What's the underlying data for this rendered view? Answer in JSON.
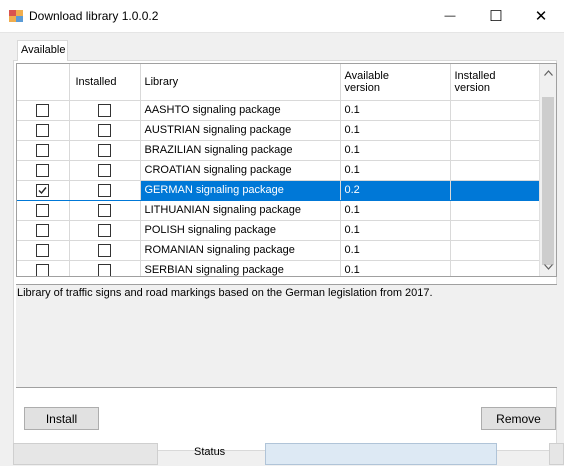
{
  "window": {
    "title": "Download library 1.0.0.2",
    "minimize_glyph": "—",
    "maximize_glyph": "☐",
    "close_glyph": "✕"
  },
  "tabs": [
    {
      "label": "Available"
    }
  ],
  "grid": {
    "columns": {
      "select": "",
      "installed": "Installed",
      "library": "Library",
      "available_version_1": "Available",
      "available_version_2": "version",
      "installed_version_1": "Installed",
      "installed_version_2": "version"
    },
    "rows": [
      {
        "selected": false,
        "installed": false,
        "library": "AASHTO signaling package",
        "available_version": "0.1",
        "installed_version": ""
      },
      {
        "selected": false,
        "installed": false,
        "library": "AUSTRIAN signaling package",
        "available_version": "0.1",
        "installed_version": ""
      },
      {
        "selected": false,
        "installed": false,
        "library": "BRAZILIAN signaling package",
        "available_version": "0.1",
        "installed_version": ""
      },
      {
        "selected": false,
        "installed": false,
        "library": "CROATIAN signaling package",
        "available_version": "0.1",
        "installed_version": ""
      },
      {
        "selected": true,
        "installed": false,
        "library": "GERMAN signaling package",
        "available_version": "0.2",
        "installed_version": "",
        "highlighted": true
      },
      {
        "selected": false,
        "installed": false,
        "library": "LITHUANIAN signaling package",
        "available_version": "0.1",
        "installed_version": ""
      },
      {
        "selected": false,
        "installed": false,
        "library": "POLISH signaling package",
        "available_version": "0.1",
        "installed_version": ""
      },
      {
        "selected": false,
        "installed": false,
        "library": "ROMANIAN signaling package",
        "available_version": "0.1",
        "installed_version": ""
      },
      {
        "selected": false,
        "installed": false,
        "library": "SERBIAN signaling package",
        "available_version": "0.1",
        "installed_version": ""
      }
    ]
  },
  "description": "Library of traffic signs and road markings based on the German legislation from 2017.",
  "buttons": {
    "install": "Install",
    "remove": "Remove"
  },
  "status": {
    "label": "Status"
  },
  "colors": {
    "selection": "#0078d7",
    "title_icon_primary": "#d9534f",
    "title_icon_secondary": "#f0ad4e"
  },
  "icons": {
    "title": "app-icon",
    "scroll_up": "chevron-up-icon",
    "scroll_down": "chevron-down-icon"
  }
}
